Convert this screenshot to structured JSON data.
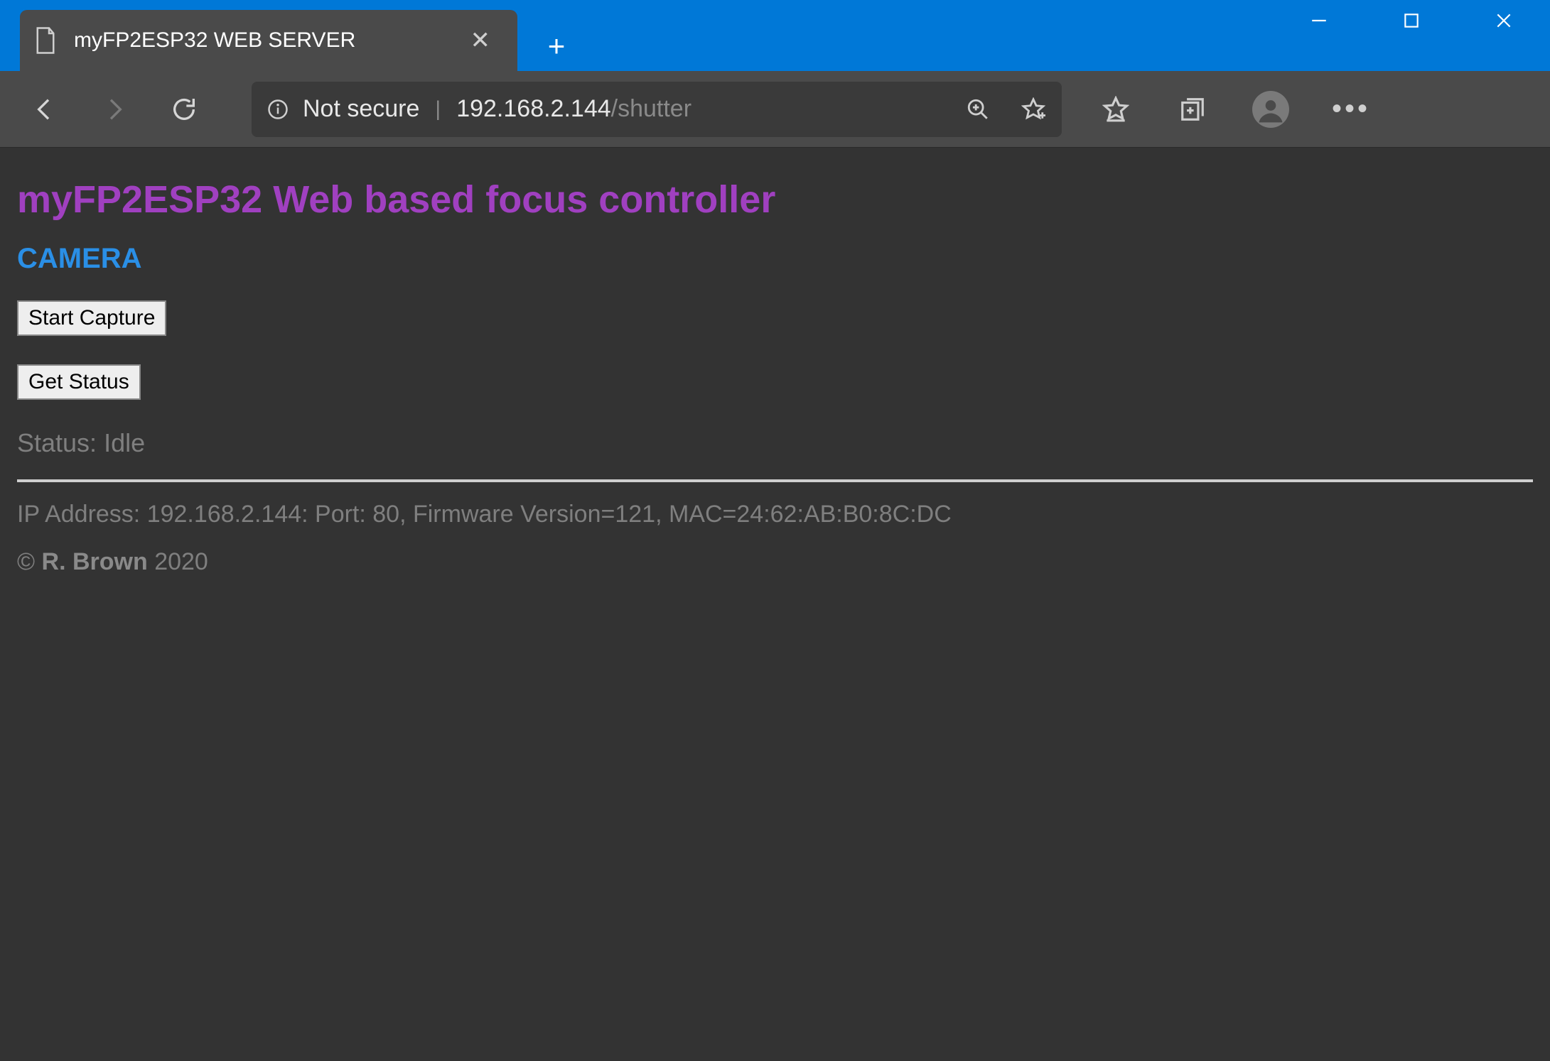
{
  "window": {
    "tab_title": "myFP2ESP32 WEB SERVER"
  },
  "address": {
    "security_label": "Not secure",
    "host": "192.168.2.144",
    "path": "/shutter"
  },
  "page": {
    "title": "myFP2ESP32 Web based focus controller",
    "section": "CAMERA",
    "buttons": {
      "start_capture": "Start Capture",
      "get_status": "Get Status"
    },
    "status_text": "Status: Idle",
    "footer_info": "IP Address: 192.168.2.144: Port: 80, Firmware Version=121, MAC=24:62:AB:B0:8C:DC",
    "copyright_symbol": "©",
    "author": "R. Brown",
    "year": "2020"
  }
}
